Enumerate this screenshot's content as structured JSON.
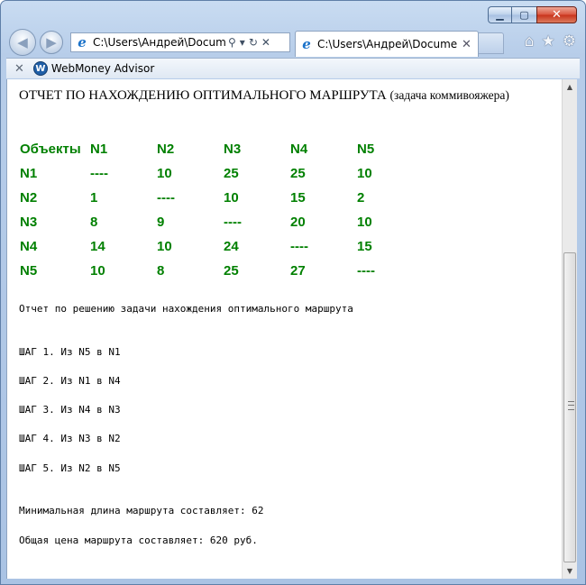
{
  "browser": {
    "address_text": "C:\\Users\\Андрей\\Documer",
    "tab_text": "C:\\Users\\Андрей\\Docume...",
    "toolbar_label": "WebMoney Advisor"
  },
  "report": {
    "title_main": "ОТЧЕТ ПО НАХОЖДЕНИЮ ОПТИМАЛЬНОГО МАРШРУТА",
    "title_sub": "(задача коммивояжера)",
    "table": {
      "header": [
        "Объекты",
        "N1",
        "N2",
        "N3",
        "N4",
        "N5"
      ],
      "rows": [
        [
          "N1",
          "----",
          "10",
          "25",
          "25",
          "10"
        ],
        [
          "N2",
          "1",
          "----",
          "10",
          "15",
          "2"
        ],
        [
          "N3",
          "8",
          "9",
          "----",
          "20",
          "10"
        ],
        [
          "N4",
          "14",
          "10",
          "24",
          "----",
          "15"
        ],
        [
          "N5",
          "10",
          "8",
          "25",
          "27",
          "----"
        ]
      ]
    },
    "solution_heading": "Отчет по решению задачи нахождения оптимального маршрута",
    "steps": [
      "ШАГ 1. Из N5 в N1",
      "ШАГ 2. Из N1 в N4",
      "ШАГ 3. Из N4 в N3",
      "ШАГ 4. Из N3 в N2",
      "ШАГ 5. Из N2 в N5"
    ],
    "min_length": "Минимальная длина маршрута составляет: 62",
    "total_price": "Общая цена маршрута составляет: 620 руб."
  },
  "colors": {
    "table_text": "#008000",
    "close_button": "#c8321a"
  },
  "icons": [
    "back-arrow-icon",
    "forward-arrow-icon",
    "ie-logo-icon",
    "search-icon",
    "dropdown-icon",
    "refresh-icon",
    "close-icon",
    "home-icon",
    "favorites-star-icon",
    "settings-gear-icon",
    "webmoney-logo-icon"
  ]
}
